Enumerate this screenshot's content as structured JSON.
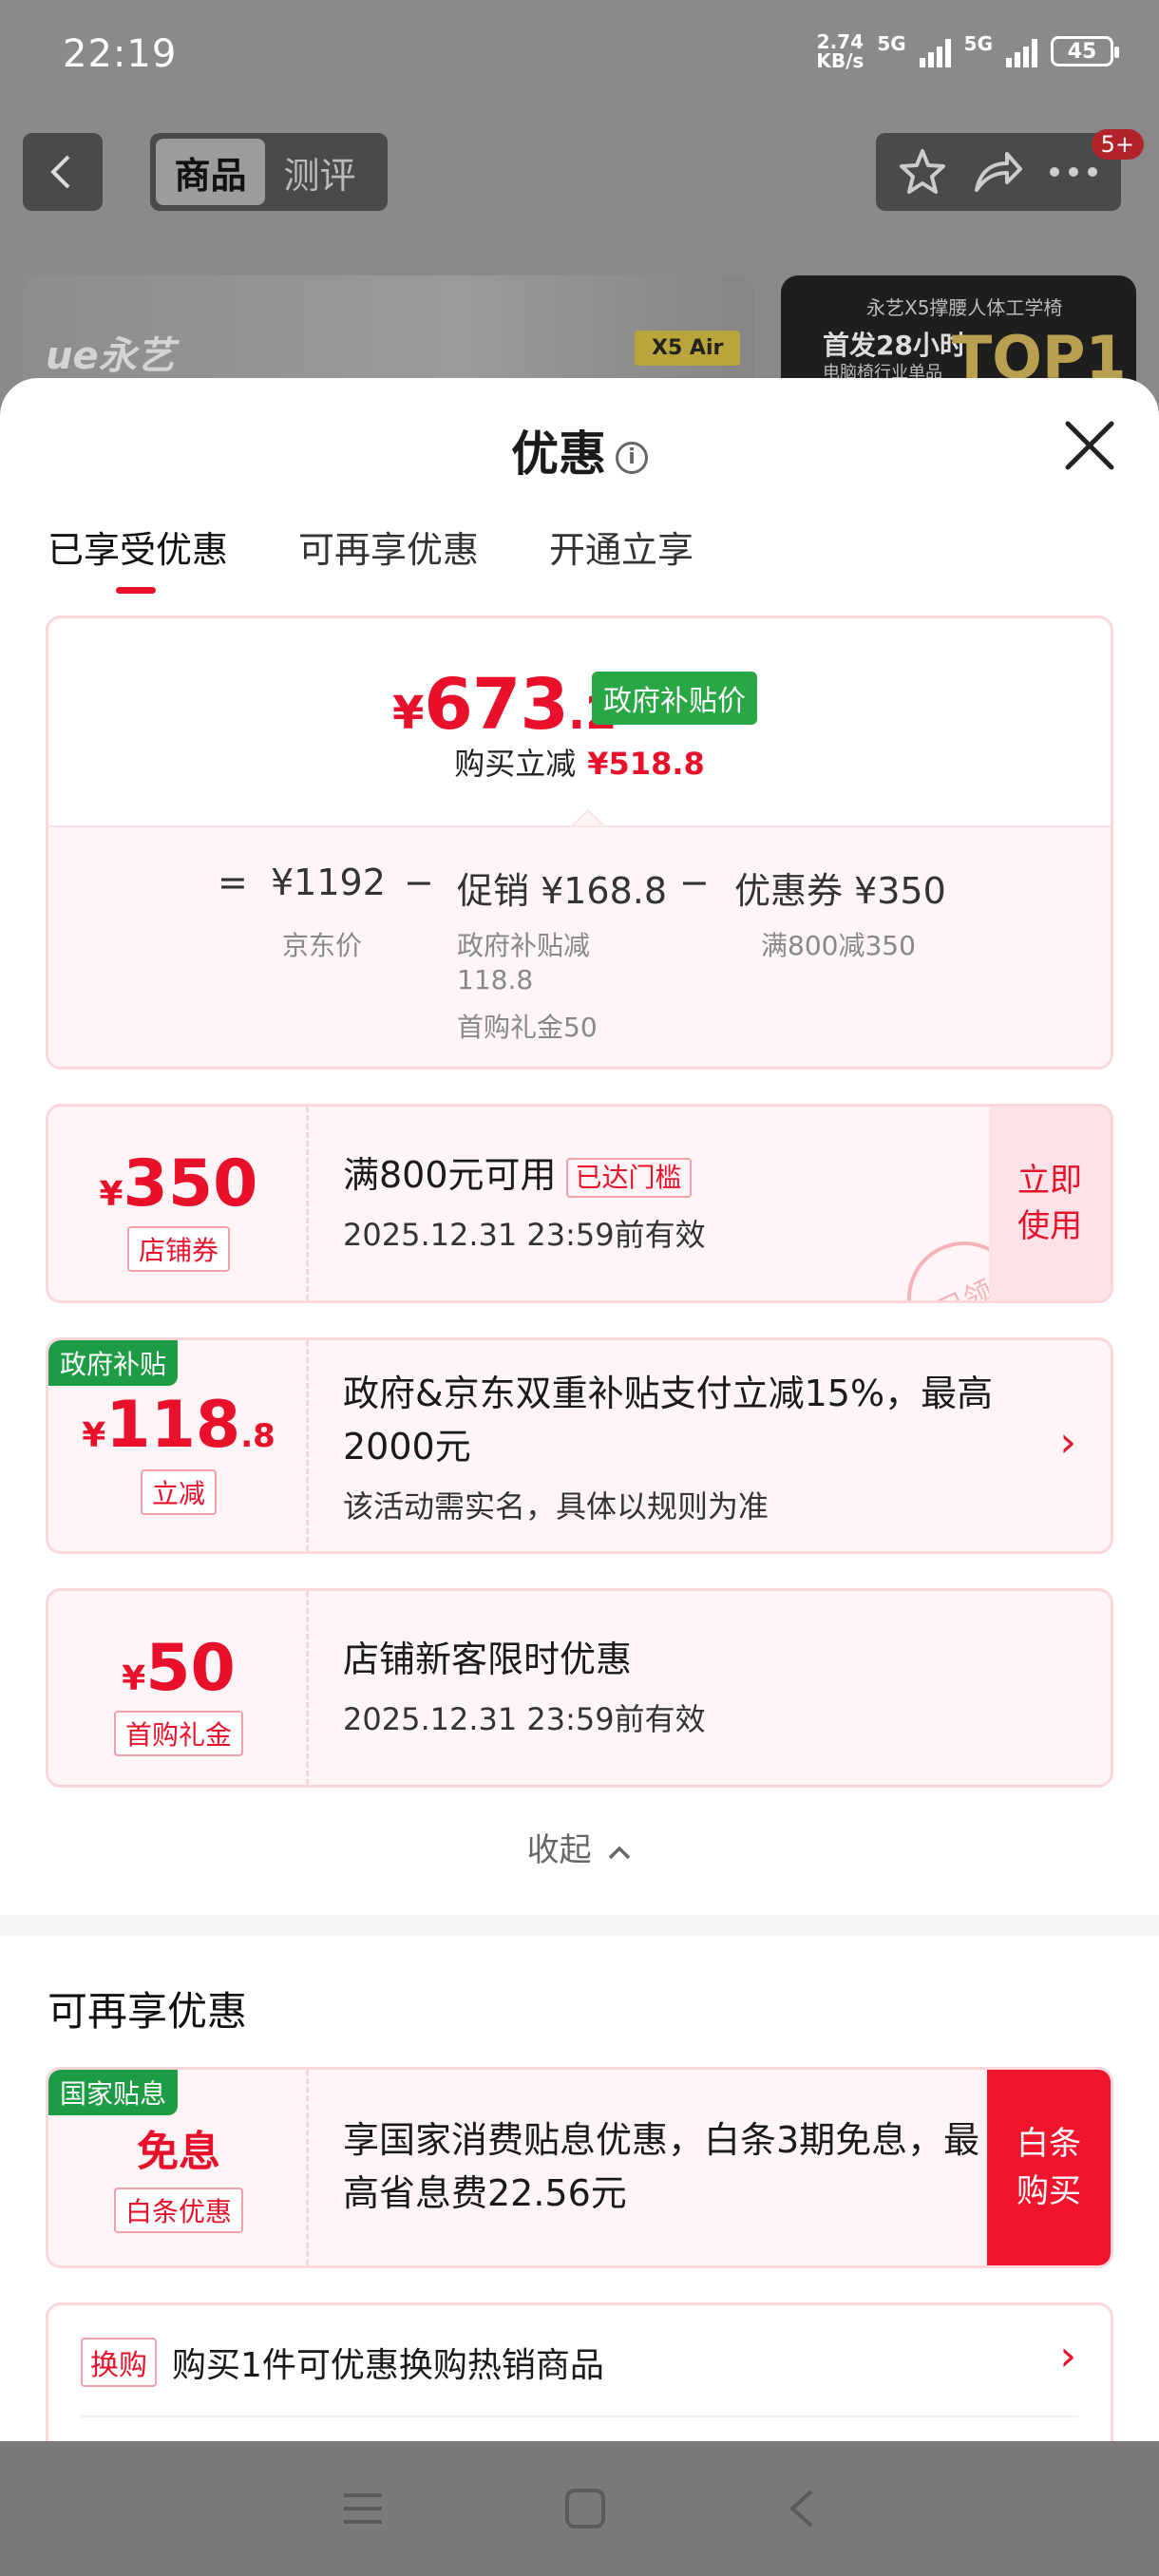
{
  "status": {
    "time": "22:19",
    "net_speed_value": "2.74",
    "net_speed_unit": "KB/s",
    "sig1": "5G",
    "sig2": "5G",
    "battery": "45"
  },
  "nav": {
    "tab_goods": "商品",
    "tab_review": "测评",
    "badge": "5+"
  },
  "banner": {
    "logo": "ue永艺",
    "tag": "X5 Air",
    "right_line1": "永艺X5撑腰人体工学椅",
    "right_line2": "首发28小时",
    "right_line3": "电脑椅行业单品",
    "right_top": "TOP1"
  },
  "sheet": {
    "title": "优惠",
    "info_icon_text": "i",
    "tabs": [
      "已享受优惠",
      "可再享优惠",
      "开通立享"
    ]
  },
  "summary": {
    "price_yen": "¥",
    "price_int": "673",
    "price_dec": ".2",
    "gov_badge": "政府补贴价",
    "direct_cut_label": "购买立减",
    "direct_cut_value": "¥518.8",
    "eq": "=",
    "jd_price": "¥1192",
    "minus1": "−",
    "promo": "促销 ¥168.8",
    "minus2": "−",
    "coupon": "优惠券 ¥350",
    "jd_price_label": "京东价",
    "promo_sub1": "政府补贴减",
    "promo_sub2": "118.8",
    "promo_sub3": "首购礼金50",
    "coupon_sub": "满800减350"
  },
  "coupons": {
    "c1": {
      "yen": "¥",
      "num": "350",
      "tag": "店铺券",
      "title": "满800元可用",
      "reached": "已达门槛",
      "valid": "2025.12.31 23:59前有效",
      "btn": "立即使用",
      "stamp": "已领"
    },
    "c2": {
      "badge": "政府补贴",
      "yen": "¥",
      "num": "118",
      "dec": ".8",
      "tag": "立减",
      "title": "政府&京东双重补贴支付立减15%，最高2000元",
      "sub": "该活动需实名，具体以规则为准",
      "chev": "›"
    },
    "c3": {
      "yen": "¥",
      "num": "50",
      "tag": "首购礼金",
      "title": "店铺新客限时优惠",
      "valid": "2025.12.31 23:59前有效"
    }
  },
  "collapse_label": "收起",
  "more": {
    "title": "可再享优惠",
    "interest": {
      "badge": "国家贴息",
      "main": "免息",
      "tag": "白条优惠",
      "text": "享国家消费贴息优惠，白条3期免息，最高省息费22.56元",
      "btn": "白条购买"
    },
    "exchange": {
      "tag": "换购",
      "text": "购买1件可优惠换购热销商品",
      "chev": "›"
    }
  },
  "colors": {
    "accent": "#e8102a",
    "gov_green": "#29a745",
    "card_border": "#fbd6da",
    "card_bg": "#fff5f6"
  }
}
